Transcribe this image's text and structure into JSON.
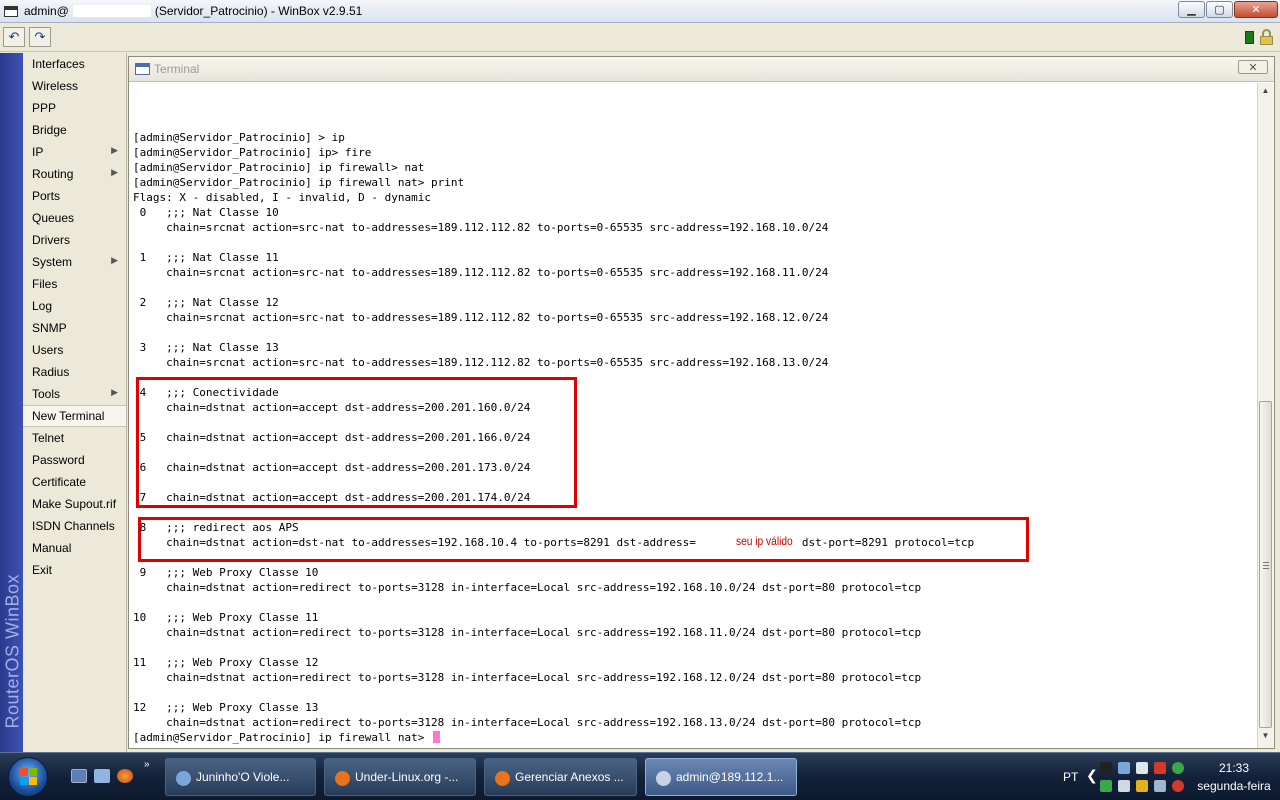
{
  "window": {
    "title_user": "admin@",
    "title_rest": "(Servidor_Patrocinio) - WinBox v2.9.51",
    "minimize_label": "▁",
    "maximize_label": "▢",
    "close_label": "✕"
  },
  "toolbar": {
    "undo_label": "↶",
    "redo_label": "↷"
  },
  "brand": "RouterOS WinBox",
  "menu": {
    "items": [
      {
        "label": "Interfaces"
      },
      {
        "label": "Wireless"
      },
      {
        "label": "PPP"
      },
      {
        "label": "Bridge"
      },
      {
        "label": "IP",
        "submenu": true
      },
      {
        "label": "Routing",
        "submenu": true
      },
      {
        "label": "Ports"
      },
      {
        "label": "Queues"
      },
      {
        "label": "Drivers"
      },
      {
        "label": "System",
        "submenu": true
      },
      {
        "label": "Files"
      },
      {
        "label": "Log"
      },
      {
        "label": "SNMP"
      },
      {
        "label": "Users"
      },
      {
        "label": "Radius"
      },
      {
        "label": "Tools",
        "submenu": true
      },
      {
        "label": "New Terminal",
        "active": true
      },
      {
        "label": "Telnet"
      },
      {
        "label": "Password"
      },
      {
        "label": "Certificate"
      },
      {
        "label": "Make Supout.rif"
      },
      {
        "label": "ISDN Channels"
      },
      {
        "label": "Manual"
      },
      {
        "label": "Exit"
      }
    ]
  },
  "terminal": {
    "title": "Terminal",
    "close_label": "✕",
    "lines": [
      "[admin@Servidor_Patrocinio] > ip",
      "[admin@Servidor_Patrocinio] ip> fire",
      "[admin@Servidor_Patrocinio] ip firewall> nat",
      "[admin@Servidor_Patrocinio] ip firewall nat> print",
      "Flags: X - disabled, I - invalid, D - dynamic",
      " 0   ;;; Nat Classe 10",
      "     chain=srcnat action=src-nat to-addresses=189.112.112.82 to-ports=0-65535 src-address=192.168.10.0/24",
      "",
      " 1   ;;; Nat Classe 11",
      "     chain=srcnat action=src-nat to-addresses=189.112.112.82 to-ports=0-65535 src-address=192.168.11.0/24",
      "",
      " 2   ;;; Nat Classe 12",
      "     chain=srcnat action=src-nat to-addresses=189.112.112.82 to-ports=0-65535 src-address=192.168.12.0/24",
      "",
      " 3   ;;; Nat Classe 13",
      "     chain=srcnat action=src-nat to-addresses=189.112.112.82 to-ports=0-65535 src-address=192.168.13.0/24",
      "",
      " 4   ;;; Conectividade",
      "     chain=dstnat action=accept dst-address=200.201.160.0/24",
      "",
      " 5   chain=dstnat action=accept dst-address=200.201.166.0/24",
      "",
      " 6   chain=dstnat action=accept dst-address=200.201.173.0/24",
      "",
      " 7   chain=dstnat action=accept dst-address=200.201.174.0/24",
      "",
      " 8   ;;; redirect aos APS",
      "     chain=dstnat action=dst-nat to-addresses=192.168.10.4 to-ports=8291 dst-address=                dst-port=8291 protocol=tcp",
      "",
      " 9   ;;; Web Proxy Classe 10",
      "     chain=dstnat action=redirect to-ports=3128 in-interface=Local src-address=192.168.10.0/24 dst-port=80 protocol=tcp",
      "",
      "10   ;;; Web Proxy Classe 11",
      "     chain=dstnat action=redirect to-ports=3128 in-interface=Local src-address=192.168.11.0/24 dst-port=80 protocol=tcp",
      "",
      "11   ;;; Web Proxy Classe 12",
      "     chain=dstnat action=redirect to-ports=3128 in-interface=Local src-address=192.168.12.0/24 dst-port=80 protocol=tcp",
      "",
      "12   ;;; Web Proxy Classe 13",
      "     chain=dstnat action=redirect to-ports=3128 in-interface=Local src-address=192.168.13.0/24 dst-port=80 protocol=tcp",
      "[admin@Servidor_Patrocinio] ip firewall nat> "
    ],
    "annotation": "seu ip válido"
  },
  "taskbar": {
    "tasks": [
      {
        "label": "Juninho'O  Viole...",
        "color": "#7aa6d8"
      },
      {
        "label": "Under-Linux.org -...",
        "color": "#e8731c"
      },
      {
        "label": "Gerenciar Anexos ...",
        "color": "#e8731c"
      },
      {
        "label": "admin@189.112.1...",
        "color": "#c8d4e6",
        "active": true
      }
    ],
    "language": "PT",
    "chevron": "❮",
    "time": "21:33",
    "day": "segunda-feira"
  },
  "colors": {
    "highlight_red": "#e00000",
    "cursor_pink": "#ff77cc",
    "brand_blue": "#2a3a8c"
  }
}
